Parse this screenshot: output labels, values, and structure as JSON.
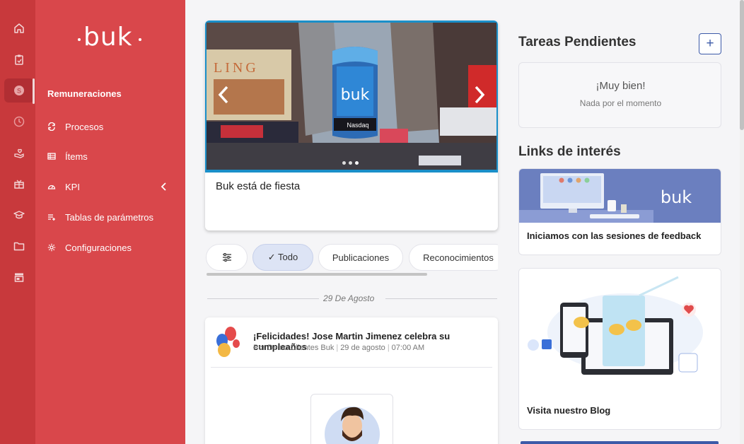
{
  "brand": {
    "logo_text": "buk"
  },
  "rail": {
    "items": [
      {
        "icon": "home-icon"
      },
      {
        "icon": "clipboard-icon"
      },
      {
        "icon": "payroll-icon"
      },
      {
        "icon": "clock-icon"
      },
      {
        "icon": "hand-heart-icon"
      },
      {
        "icon": "gift-icon"
      },
      {
        "icon": "graduation-cap-icon"
      },
      {
        "icon": "folder-icon"
      },
      {
        "icon": "store-icon"
      }
    ]
  },
  "menu": {
    "section_title": "Remuneraciones",
    "items": [
      {
        "label": "Procesos",
        "icon": "refresh-icon"
      },
      {
        "label": "Ítems",
        "icon": "list-icon"
      },
      {
        "label": "KPI",
        "icon": "gauge-icon"
      },
      {
        "label": "Tablas de parámetros",
        "icon": "add-list-icon"
      },
      {
        "label": "Configuraciones",
        "icon": "gear-icon"
      }
    ]
  },
  "carousel": {
    "caption": "Buk está de fiesta",
    "slide_count": 3,
    "active_slide": 3,
    "image_texts": {
      "screen_logo": "buk",
      "nasdaq": "Nasdaq",
      "billboard": "LING"
    }
  },
  "filters": {
    "chips": [
      {
        "label": ""
      },
      {
        "label": "✓ Todo",
        "active": true
      },
      {
        "label": "Publicaciones"
      },
      {
        "label": "Reconocimientos"
      }
    ]
  },
  "feed": {
    "date_label": "29 De Agosto",
    "post": {
      "title": "¡Felicidades! Jose Martin Jimenez celebra su cumpleaños",
      "author": "Por Demo Clientes Buk",
      "date": "29 de agosto",
      "time": "07:00 AM"
    }
  },
  "tasks": {
    "heading": "Tareas Pendientes",
    "add_label": "+",
    "empty_title": "¡Muy bien!",
    "empty_subtitle": "Nada por el momento"
  },
  "links": {
    "heading": "Links de interés",
    "cards": [
      {
        "label": "Iniciamos con las sesiones de feedback",
        "banner_logo": "buk"
      },
      {
        "label": "Visita nuestro Blog"
      }
    ]
  },
  "colors": {
    "rail": "#c8393c",
    "menu": "#d9474b",
    "accent": "#3c5aa8",
    "carousel_border": "#1a8fc9"
  }
}
